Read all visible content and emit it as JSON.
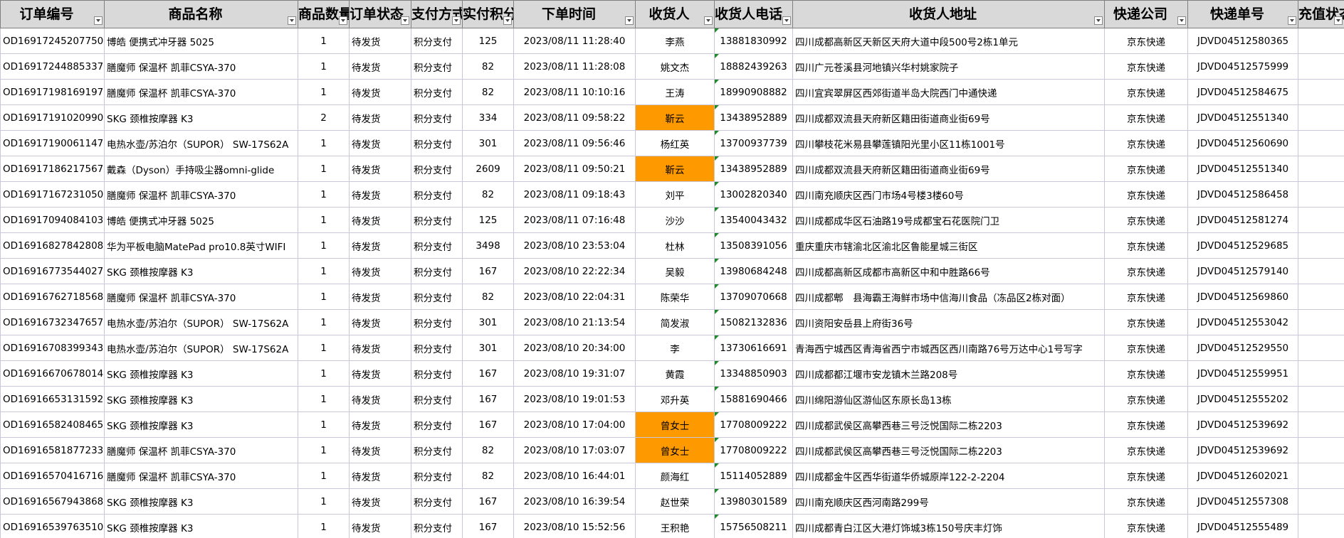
{
  "headers": [
    "订单编号",
    "商品名称",
    "商品数量",
    "订单状态",
    "支付方式",
    "实付积分",
    "下单时间",
    "收货人",
    "收货人电话",
    "收货人地址",
    "快递公司",
    "快递单号",
    "充值状态"
  ],
  "rows": [
    {
      "id": "OD16917245207750",
      "product": "博皓 便携式冲牙器 5025",
      "qty": "1",
      "status": "待发货",
      "pay": "积分支付",
      "points": "125",
      "time": "2023/08/11 11:28:40",
      "name": "李燕",
      "highlight": false,
      "phone": "13881830992",
      "address": "四川成都高新区天新区天府大道中段500号2栋1单元",
      "courier": "京东快递",
      "tracking": "JDVD04512580365",
      "recharge": ""
    },
    {
      "id": "OD16917244885337",
      "product": "膳魔师 保温杯 凯菲CSYA-370",
      "qty": "1",
      "status": "待发货",
      "pay": "积分支付",
      "points": "82",
      "time": "2023/08/11 11:28:08",
      "name": "姚文杰",
      "highlight": false,
      "phone": "18882439263",
      "address": "四川广元苍溪县河地镇兴华村姚家院子",
      "courier": "京东快递",
      "tracking": "JDVD04512575999",
      "recharge": ""
    },
    {
      "id": "OD16917198169197",
      "product": "膳魔师 保温杯 凯菲CSYA-370",
      "qty": "1",
      "status": "待发货",
      "pay": "积分支付",
      "points": "82",
      "time": "2023/08/11 10:10:16",
      "name": "王涛",
      "highlight": false,
      "phone": "18990908882",
      "address": "四川宜宾翠屏区西郊街道半岛大院西门中通快递",
      "courier": "京东快递",
      "tracking": "JDVD04512584675",
      "recharge": ""
    },
    {
      "id": "OD16917191020990",
      "product": "SKG 颈椎按摩器 K3",
      "qty": "2",
      "status": "待发货",
      "pay": "积分支付",
      "points": "334",
      "time": "2023/08/11 09:58:22",
      "name": "靳云",
      "highlight": true,
      "phone": "13438952889",
      "address": "四川成都双流县天府新区籍田街道商业街69号",
      "courier": "京东快递",
      "tracking": "JDVD04512551340",
      "recharge": ""
    },
    {
      "id": "OD16917190061147",
      "product": "电热水壶/苏泊尔（SUPOR） SW-17S62A",
      "qty": "1",
      "status": "待发货",
      "pay": "积分支付",
      "points": "301",
      "time": "2023/08/11 09:56:46",
      "name": "杨红英",
      "highlight": false,
      "phone": "13700937739",
      "address": "四川攀枝花米易县攀莲镇阳光里小区11栋1001号",
      "courier": "京东快递",
      "tracking": "JDVD04512560690",
      "recharge": ""
    },
    {
      "id": "OD16917186217567",
      "product": "戴森（Dyson）手持吸尘器omni-glide",
      "qty": "1",
      "status": "待发货",
      "pay": "积分支付",
      "points": "2609",
      "time": "2023/08/11 09:50:21",
      "name": "靳云",
      "highlight": true,
      "phone": "13438952889",
      "address": "四川成都双流县天府新区籍田街道商业街69号",
      "courier": "京东快递",
      "tracking": "JDVD04512551340",
      "recharge": ""
    },
    {
      "id": "OD16917167231050",
      "product": "膳魔师 保温杯 凯菲CSYA-370",
      "qty": "1",
      "status": "待发货",
      "pay": "积分支付",
      "points": "82",
      "time": "2023/08/11 09:18:43",
      "name": "刘平",
      "highlight": false,
      "phone": "13002820340",
      "address": "四川南充顺庆区西门市场4号楼3楼60号",
      "courier": "京东快递",
      "tracking": "JDVD04512586458",
      "recharge": ""
    },
    {
      "id": "OD16917094084103",
      "product": "博皓 便携式冲牙器 5025",
      "qty": "1",
      "status": "待发货",
      "pay": "积分支付",
      "points": "125",
      "time": "2023/08/11 07:16:48",
      "name": "沙沙",
      "highlight": false,
      "phone": "13540043432",
      "address": "四川成都成华区石油路19号成都宝石花医院门卫",
      "courier": "京东快递",
      "tracking": "JDVD04512581274",
      "recharge": ""
    },
    {
      "id": "OD16916827842808",
      "product": "华为平板电脑MatePad pro10.8英寸WIFI",
      "qty": "1",
      "status": "待发货",
      "pay": "积分支付",
      "points": "3498",
      "time": "2023/08/10 23:53:04",
      "name": "杜林",
      "highlight": false,
      "phone": "13508391056",
      "address": "重庆重庆市辖渝北区渝北区鲁能星城三街区",
      "courier": "京东快递",
      "tracking": "JDVD04512529685",
      "recharge": ""
    },
    {
      "id": "OD16916773544027",
      "product": "SKG 颈椎按摩器 K3",
      "qty": "1",
      "status": "待发货",
      "pay": "积分支付",
      "points": "167",
      "time": "2023/08/10 22:22:34",
      "name": "吴毅",
      "highlight": false,
      "phone": "13980684248",
      "address": "四川成都高新区成都市高新区中和中胜路66号",
      "courier": "京东快递",
      "tracking": "JDVD04512579140",
      "recharge": ""
    },
    {
      "id": "OD16916762718568",
      "product": "膳魔师 保温杯 凯菲CSYA-370",
      "qty": "1",
      "status": "待发货",
      "pay": "积分支付",
      "points": "82",
      "time": "2023/08/10 22:04:31",
      "name": "陈荣华",
      "highlight": false,
      "phone": "13709070668",
      "address": "四川成都郫　县海霸王海鲜市场中信海川食品（冻品区2栋对面）",
      "courier": "京东快递",
      "tracking": "JDVD04512569860",
      "recharge": ""
    },
    {
      "id": "OD16916732347657",
      "product": "电热水壶/苏泊尔（SUPOR） SW-17S62A",
      "qty": "1",
      "status": "待发货",
      "pay": "积分支付",
      "points": "301",
      "time": "2023/08/10 21:13:54",
      "name": "简发淑",
      "highlight": false,
      "phone": "15082132836",
      "address": "四川资阳安岳县上府街36号",
      "courier": "京东快递",
      "tracking": "JDVD04512553042",
      "recharge": ""
    },
    {
      "id": "OD16916708399343",
      "product": "电热水壶/苏泊尔（SUPOR） SW-17S62A",
      "qty": "1",
      "status": "待发货",
      "pay": "积分支付",
      "points": "301",
      "time": "2023/08/10 20:34:00",
      "name": "李",
      "highlight": false,
      "phone": "13730616691",
      "address": "青海西宁城西区青海省西宁市城西区西川南路76号万达中心1号写字",
      "courier": "京东快递",
      "tracking": "JDVD04512529550",
      "recharge": ""
    },
    {
      "id": "OD16916670678014",
      "product": "SKG 颈椎按摩器 K3",
      "qty": "1",
      "status": "待发货",
      "pay": "积分支付",
      "points": "167",
      "time": "2023/08/10 19:31:07",
      "name": "黄霞",
      "highlight": false,
      "phone": "13348850903",
      "address": "四川成都都江堰市安龙镇木兰路208号",
      "courier": "京东快递",
      "tracking": "JDVD04512559951",
      "recharge": ""
    },
    {
      "id": "OD16916653131592",
      "product": "SKG 颈椎按摩器 K3",
      "qty": "1",
      "status": "待发货",
      "pay": "积分支付",
      "points": "167",
      "time": "2023/08/10 19:01:53",
      "name": "邓升英",
      "highlight": false,
      "phone": "15881690466",
      "address": "四川绵阳游仙区游仙区东原长岛13栋",
      "courier": "京东快递",
      "tracking": "JDVD04512555202",
      "recharge": ""
    },
    {
      "id": "OD16916582408465",
      "product": "SKG 颈椎按摩器 K3",
      "qty": "1",
      "status": "待发货",
      "pay": "积分支付",
      "points": "167",
      "time": "2023/08/10 17:04:00",
      "name": "曾女士",
      "highlight": true,
      "phone": "17708009222",
      "address": "四川成都武侯区高攀西巷三号泛悦国际二栋2203",
      "courier": "京东快递",
      "tracking": "JDVD04512539692",
      "recharge": ""
    },
    {
      "id": "OD16916581877233",
      "product": "膳魔师 保温杯 凯菲CSYA-370",
      "qty": "1",
      "status": "待发货",
      "pay": "积分支付",
      "points": "82",
      "time": "2023/08/10 17:03:07",
      "name": "曾女士",
      "highlight": true,
      "phone": "17708009222",
      "address": "四川成都武侯区高攀西巷三号泛悦国际二栋2203",
      "courier": "京东快递",
      "tracking": "JDVD04512539692",
      "recharge": ""
    },
    {
      "id": "OD16916570416716",
      "product": "膳魔师 保温杯 凯菲CSYA-370",
      "qty": "1",
      "status": "待发货",
      "pay": "积分支付",
      "points": "82",
      "time": "2023/08/10 16:44:01",
      "name": "颜海红",
      "highlight": false,
      "phone": "15114052889",
      "address": "四川成都金牛区西华街道华侨城原岸122-2-2204",
      "courier": "京东快递",
      "tracking": "JDVD04512602021",
      "recharge": ""
    },
    {
      "id": "OD16916567943868",
      "product": "SKG 颈椎按摩器 K3",
      "qty": "1",
      "status": "待发货",
      "pay": "积分支付",
      "points": "167",
      "time": "2023/08/10 16:39:54",
      "name": "赵世荣",
      "highlight": false,
      "phone": "13980301589",
      "address": "四川南充顺庆区西河南路299号",
      "courier": "京东快递",
      "tracking": "JDVD04512557308",
      "recharge": ""
    },
    {
      "id": "OD16916539763510",
      "product": "SKG 颈椎按摩器 K3",
      "qty": "1",
      "status": "待发货",
      "pay": "积分支付",
      "points": "167",
      "time": "2023/08/10 15:52:56",
      "name": "王积艳",
      "highlight": false,
      "phone": "15756508211",
      "address": "四川成都青白江区大港灯饰城3栋150号庆丰灯饰",
      "courier": "京东快递",
      "tracking": "JDVD04512555489",
      "recharge": ""
    }
  ],
  "colors": {
    "header_bg": "#d9d9d9",
    "highlight": "#ff9900",
    "comment_marker": "#1a8a2a",
    "grid": "#c8c8d8"
  }
}
